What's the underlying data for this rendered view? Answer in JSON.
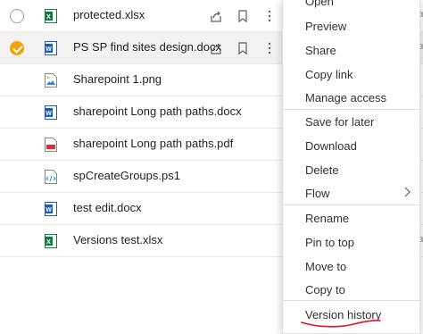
{
  "files": [
    {
      "name": "protected.xlsx",
      "type": "excel",
      "selected": false,
      "show_actions": true
    },
    {
      "name": "PS SP find sites design.docx",
      "type": "word",
      "selected": true,
      "show_actions": true
    },
    {
      "name": "Sharepoint 1.png",
      "type": "image",
      "selected": false,
      "show_actions": false
    },
    {
      "name": "sharepoint Long path paths.docx",
      "type": "word",
      "selected": false,
      "show_actions": false
    },
    {
      "name": "sharepoint Long path paths.pdf",
      "type": "pdf",
      "selected": false,
      "show_actions": false
    },
    {
      "name": "spCreateGroups.ps1",
      "type": "script",
      "selected": false,
      "show_actions": false
    },
    {
      "name": "test edit.docx",
      "type": "word",
      "selected": false,
      "show_actions": false
    },
    {
      "name": "Versions test.xlsx",
      "type": "excel",
      "selected": false,
      "show_actions": false
    }
  ],
  "edge_text": [
    "ia",
    "ia",
    "ia"
  ],
  "context_menu": {
    "items": {
      "open": "Open",
      "preview": "Preview",
      "share": "Share",
      "copy_link": "Copy link",
      "manage_access": "Manage access",
      "save_for_later": "Save for later",
      "download": "Download",
      "delete": "Delete",
      "flow": "Flow",
      "rename": "Rename",
      "pin_to_top": "Pin to top",
      "move_to": "Move to",
      "copy_to": "Copy to",
      "version_history": "Version history"
    }
  },
  "colors": {
    "accent_check": "#f0a30a",
    "excel": "#107c41",
    "word": "#185abd",
    "pdf": "#d13438",
    "annotation_underline": "#e81123"
  }
}
